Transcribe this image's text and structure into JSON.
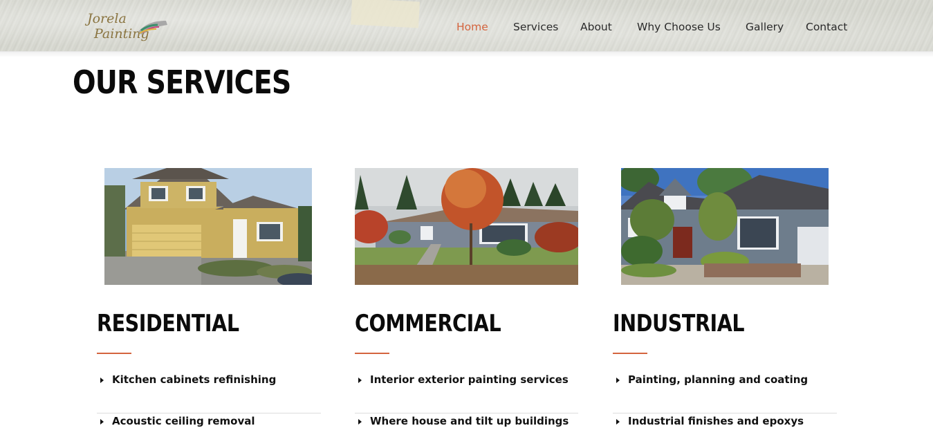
{
  "brand": {
    "logo_line1": "Jorela",
    "logo_line2": "Painting"
  },
  "nav": {
    "items": [
      {
        "label": "Home",
        "active": true
      },
      {
        "label": "Services"
      },
      {
        "label": "About"
      },
      {
        "label": "Why Choose Us"
      },
      {
        "label": "Gallery"
      },
      {
        "label": "Contact"
      }
    ]
  },
  "colors": {
    "accent": "#d4643e",
    "text": "#0b0b0b",
    "divider": "#dcdcdc"
  },
  "page": {
    "title": "OUR SERVICES"
  },
  "services": [
    {
      "title": "RESIDENTIAL",
      "image": "yellow-two-story-house-photo",
      "items": [
        "Kitchen cabinets refinishing",
        "Acoustic ceiling removal"
      ]
    },
    {
      "title": "COMMERCIAL",
      "image": "ranch-house-autumn-tree-photo",
      "items": [
        "Interior exterior painting services",
        "Where house and tilt up buildings"
      ]
    },
    {
      "title": "INDUSTRIAL",
      "image": "blue-gray-house-garden-photo",
      "items": [
        "Painting, planning and coating",
        "Industrial finishes and epoxys"
      ]
    }
  ]
}
